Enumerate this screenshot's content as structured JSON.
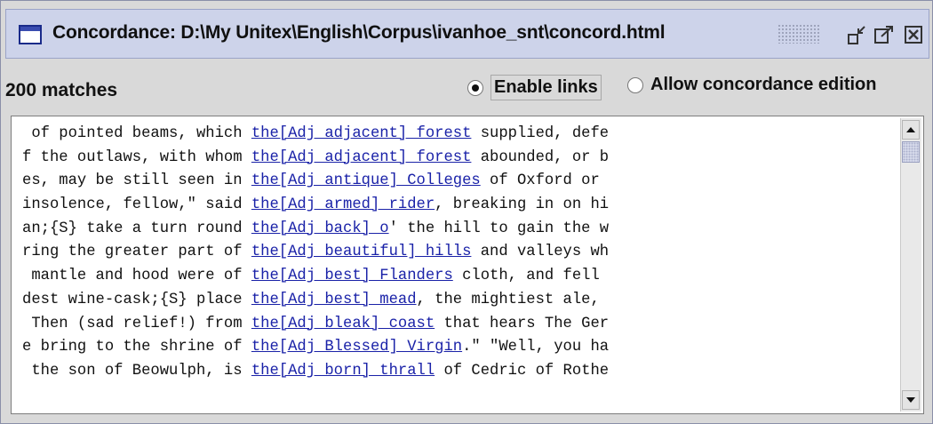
{
  "window": {
    "title": "Concordance: D:\\My Unitex\\English\\Corpus\\ivanhoe_snt\\concord.html",
    "icons": [
      "window-icon",
      "minimize-icon",
      "maximize-icon",
      "close-icon"
    ]
  },
  "toolbar": {
    "matches_label": "200 matches",
    "enable_links_label": "Enable links",
    "enable_links_selected": true,
    "allow_edition_label": "Allow concordance edition",
    "allow_edition_selected": false
  },
  "concordance": {
    "rows": [
      {
        "left": " of pointed beams, which ",
        "match": "the[Adj adjacent] forest",
        "right": " supplied, defe"
      },
      {
        "left": "f the outlaws, with whom ",
        "match": "the[Adj adjacent] forest",
        "right": " abounded, or b"
      },
      {
        "left": "es, may be still seen in ",
        "match": "the[Adj antique] Colleges",
        "right": " of Oxford or"
      },
      {
        "left": "insolence, fellow,\" said ",
        "match": "the[Adj armed] rider",
        "right": ", breaking in on hi"
      },
      {
        "left": "an;{S} take a turn round ",
        "match": "the[Adj back] o",
        "right": "' the hill to gain the w"
      },
      {
        "left": "ring the greater part of ",
        "match": "the[Adj beautiful] hills",
        "right": " and valleys wh"
      },
      {
        "left": " mantle and hood were of ",
        "match": "the[Adj best] Flanders",
        "right": " cloth, and fell"
      },
      {
        "left": "dest wine-cask;{S} place ",
        "match": "the[Adj best] mead",
        "right": ", the mightiest ale,"
      },
      {
        "left": " Then (sad relief!) from ",
        "match": "the[Adj bleak] coast",
        "right": " that hears The Ger"
      },
      {
        "left": "e bring to the shrine of ",
        "match": "the[Adj Blessed] Virgin",
        "right": ".\" \"Well, you ha"
      },
      {
        "left": " the son of Beowulph, is ",
        "match": "the[Adj born] thrall",
        "right": " of Cedric of Rothe"
      }
    ]
  },
  "scrollbar": {
    "up_icon": "arrow-up-icon",
    "down_icon": "arrow-down-icon",
    "position": 0.0
  }
}
